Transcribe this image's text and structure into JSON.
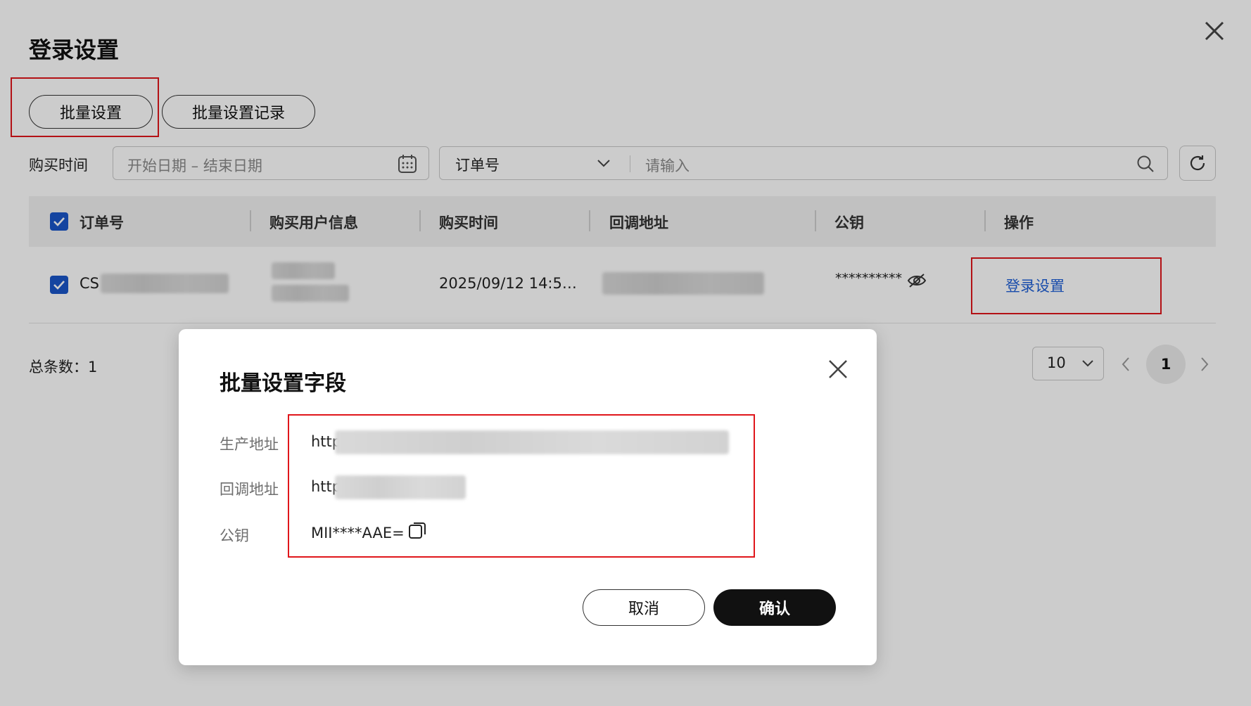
{
  "page": {
    "title": "登录设置",
    "batch_button": "批量设置",
    "batch_record_button": "批量设置记录"
  },
  "filters": {
    "purchase_time_label": "购买时间",
    "date_range_placeholder": "开始日期 – 结束日期",
    "search_field_select": "订单号",
    "search_placeholder": "请输入"
  },
  "table": {
    "columns": [
      "订单号",
      "购买用户信息",
      "购买时间",
      "回调地址",
      "公钥",
      "操作"
    ],
    "rows": [
      {
        "order_no_prefix": "CS",
        "purchase_time": "2025/09/12 14:5…",
        "public_key_masked": "**********",
        "action": "登录设置"
      }
    ]
  },
  "pagination": {
    "total_label": "总条数：1",
    "page_size": "10",
    "current_page": "1"
  },
  "modal": {
    "title": "批量设置字段",
    "fields": [
      {
        "label": "生产地址",
        "value": "http"
      },
      {
        "label": "回调地址",
        "value": "http"
      },
      {
        "label": "公钥",
        "value": "MII****AAE="
      }
    ],
    "cancel_label": "取消",
    "confirm_label": "确认"
  },
  "colors": {
    "accent_blue": "#1a56c9",
    "highlight_red": "#e0161b",
    "primary_button": "#111111"
  }
}
